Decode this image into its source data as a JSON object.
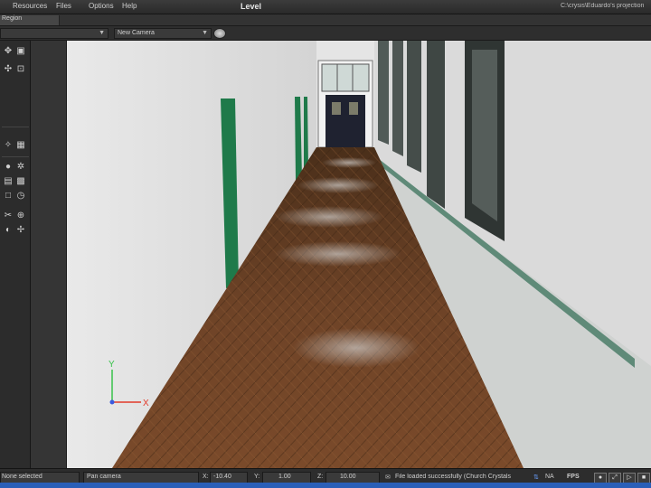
{
  "menubar": {
    "items": [
      {
        "label": "Resources",
        "accel": "R"
      },
      {
        "label": "Files",
        "accel": "F"
      },
      {
        "label": "Options",
        "accel": "O"
      },
      {
        "label": "Help",
        "accel": "H"
      }
    ],
    "window_title": "Level",
    "project_path": "C:\\crysis\\Eduardo's projection"
  },
  "subbar": {
    "tab_label": "Region"
  },
  "toolbar": {
    "layer_dropdown": "",
    "camera_dropdown": "New Camera"
  },
  "statusbar": {
    "selection_text": "None selected",
    "camera_mode": "Pan camera",
    "x_label": "X:",
    "x_value": "-10.40",
    "y_label": "Y:",
    "y_value": "1.00",
    "z_label": "Z:",
    "z_value": "10.00",
    "message": "File loaded successfully (Church Crystals",
    "na_label": "NA",
    "fps_label": "FPS"
  },
  "viewport": {
    "axis_x_label": "X",
    "axis_y_label": "Y"
  },
  "colors": {
    "wall": "#e3e3e3",
    "floor": "#6b3f22",
    "door_frame": "#1f7a4a",
    "taskbar": "#2a5fb8"
  }
}
